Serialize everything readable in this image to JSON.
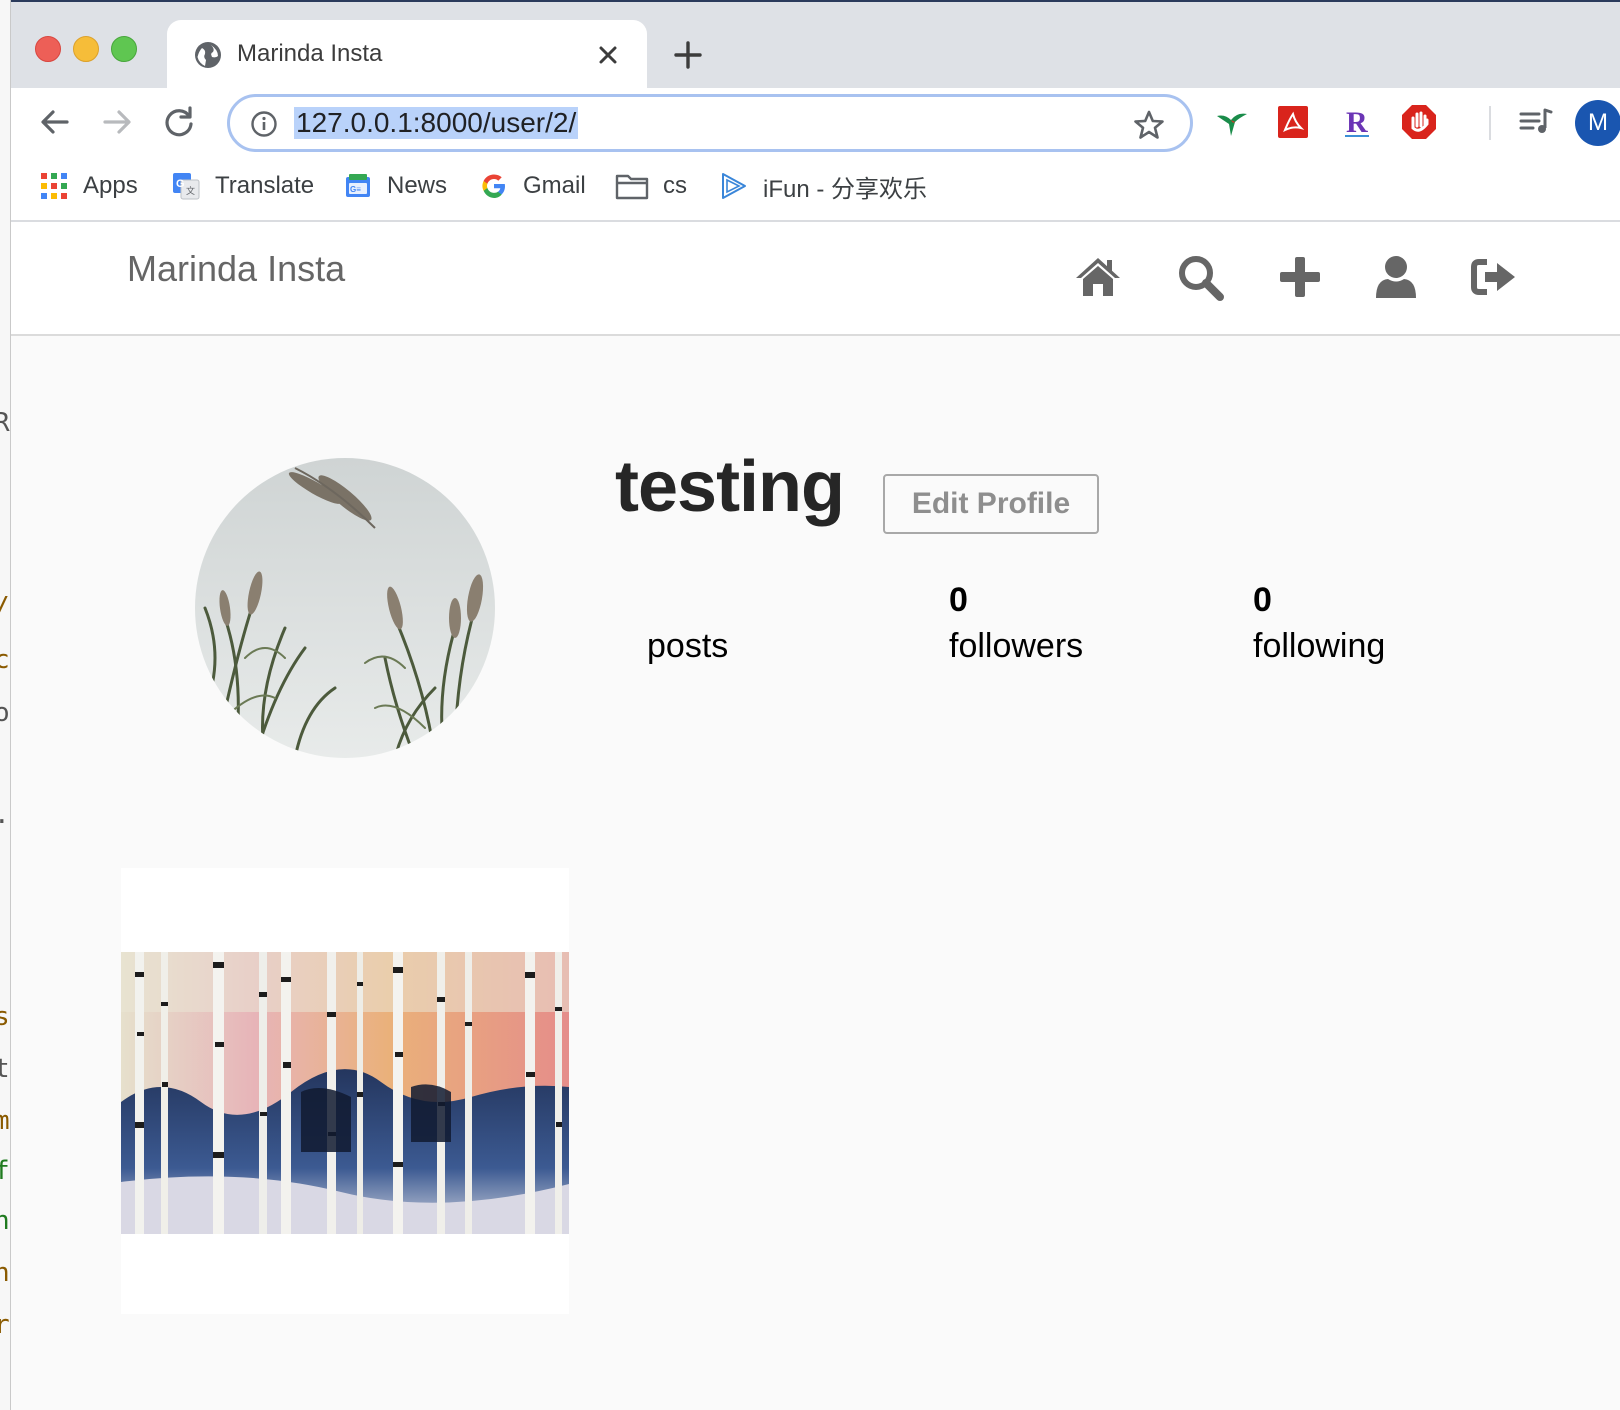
{
  "browser": {
    "tab_title": "Marinda Insta",
    "url": "127.0.0.1:8000/user/2/",
    "account_initial": "M",
    "bookmarks": [
      {
        "label": "Apps",
        "icon": "apps-grid-icon"
      },
      {
        "label": "Translate",
        "icon": "translate-icon"
      },
      {
        "label": "News",
        "icon": "news-icon"
      },
      {
        "label": "Gmail",
        "icon": "google-icon"
      },
      {
        "label": "cs",
        "icon": "folder-icon"
      },
      {
        "label": "iFun - 分享欢乐",
        "icon": "ifun-icon"
      }
    ],
    "extensions": [
      "hummingbird-icon",
      "acrobat-icon",
      "r-extension-icon",
      "adblock-icon",
      "media-queue-icon"
    ]
  },
  "site": {
    "brand": "Marinda Insta",
    "nav_icons": [
      "home-icon",
      "search-icon",
      "plus-icon",
      "user-icon",
      "logout-icon"
    ]
  },
  "profile": {
    "username": "testing",
    "edit_button": "Edit Profile",
    "stats": [
      {
        "count": "",
        "label": "posts"
      },
      {
        "count": "0",
        "label": "followers"
      },
      {
        "count": "0",
        "label": "following"
      }
    ]
  },
  "colors": {
    "page_bg": "#fafafa",
    "tab_strip": "#dee1e6",
    "url_highlight": "#b9d2fa",
    "omnibox_border": "#a8c2f0",
    "nav_icon": "#666666",
    "username": "#262626"
  }
}
